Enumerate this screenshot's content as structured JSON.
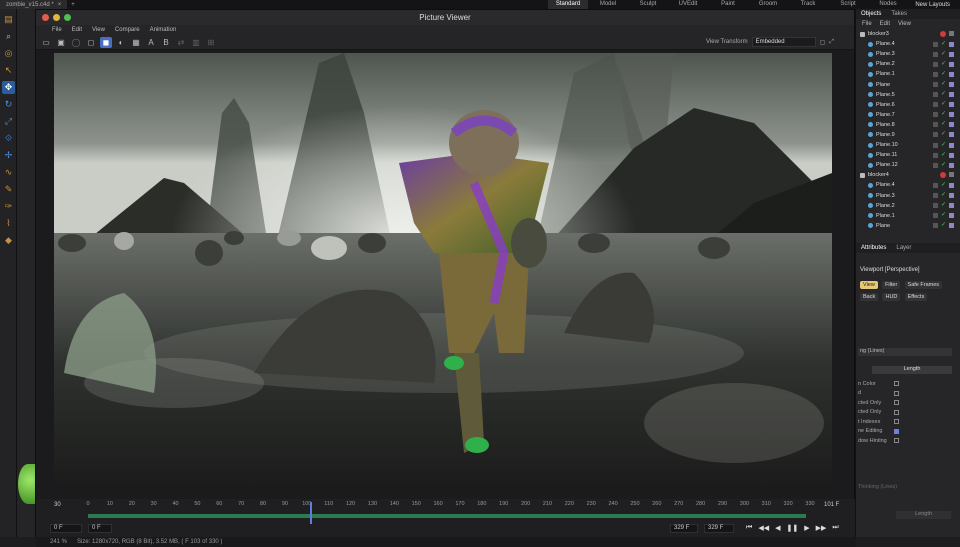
{
  "topbar": {
    "doc_tab": "zombie_v15.c4d *",
    "layouts": [
      "Standard",
      "Model",
      "Sculpt",
      "UVEdit",
      "Paint",
      "Groom",
      "Track",
      "Script",
      "Nodes"
    ],
    "active_layout": "Standard",
    "new_layouts": "New Layouts"
  },
  "viewer": {
    "title": "Picture Viewer",
    "menu": [
      "File",
      "Edit",
      "View",
      "Compare",
      "Animation"
    ],
    "view_transform_label": "View Transform",
    "view_transform_value": "Embedded",
    "toolbar_letters": [
      "A",
      "B"
    ]
  },
  "timeline": {
    "ticks": [
      "0",
      "10",
      "20",
      "30",
      "40",
      "50",
      "60",
      "70",
      "80",
      "90",
      "100",
      "110",
      "120",
      "130",
      "140",
      "150",
      "160",
      "170",
      "180",
      "190",
      "200",
      "210",
      "220",
      "230",
      "240",
      "250",
      "260",
      "270",
      "280",
      "290",
      "300",
      "310",
      "320",
      "330"
    ],
    "playhead_fraction": 0.309,
    "left_frame": "30",
    "right_frame": "101 F",
    "start_field": "0 F",
    "start_field2": "0 F",
    "end_field": "329 F",
    "end_field2": "329 F"
  },
  "status": {
    "zoom": "241 %",
    "info": "Size: 1280x720, RGB (8 Bit), 3.52 MB, ( F 103 of 330 )"
  },
  "objects": {
    "tabs": [
      "Objects",
      "Takes"
    ],
    "menu": [
      "File",
      "Edit",
      "View"
    ],
    "items": [
      {
        "label": "blocker3",
        "group": true
      },
      {
        "label": "Plane.4"
      },
      {
        "label": "Plane.3"
      },
      {
        "label": "Plane.2"
      },
      {
        "label": "Plane.1"
      },
      {
        "label": "Plane"
      },
      {
        "label": "Plane.5"
      },
      {
        "label": "Plane.6"
      },
      {
        "label": "Plane.7"
      },
      {
        "label": "Plane.8"
      },
      {
        "label": "Plane.9"
      },
      {
        "label": "Plane.10"
      },
      {
        "label": "Plane.11"
      },
      {
        "label": "Plane.12"
      },
      {
        "label": "blocker4",
        "group": true
      },
      {
        "label": "Plane.4"
      },
      {
        "label": "Plane.3"
      },
      {
        "label": "Plane.2"
      },
      {
        "label": "Plane.1"
      },
      {
        "label": "Plane"
      }
    ]
  },
  "attributes": {
    "tabs": [
      "Attributes",
      "Layer"
    ],
    "viewport_label": "Viewport [Perspective]",
    "buttons_row1": [
      "View",
      "Filter",
      "Safe Frames"
    ],
    "buttons_row2": [
      "Back",
      "HUD",
      "Effects"
    ],
    "dropdown": "ng (Lines)",
    "length_label": "Length",
    "rows": [
      "n Color",
      "d",
      "cted Only",
      "cted Only",
      "t Indexes",
      "ne Editing",
      "dow Hinting"
    ],
    "rows_checked": [
      false,
      false,
      false,
      false,
      false,
      true,
      false
    ],
    "bottom1": "Thinking (Lines)",
    "bottom2": "Length"
  },
  "colors": {
    "accent": "#4a6fc2",
    "timeline_track": "#2d7a52",
    "playhead": "#5b7fe0",
    "active_pill": "#e8c874"
  }
}
